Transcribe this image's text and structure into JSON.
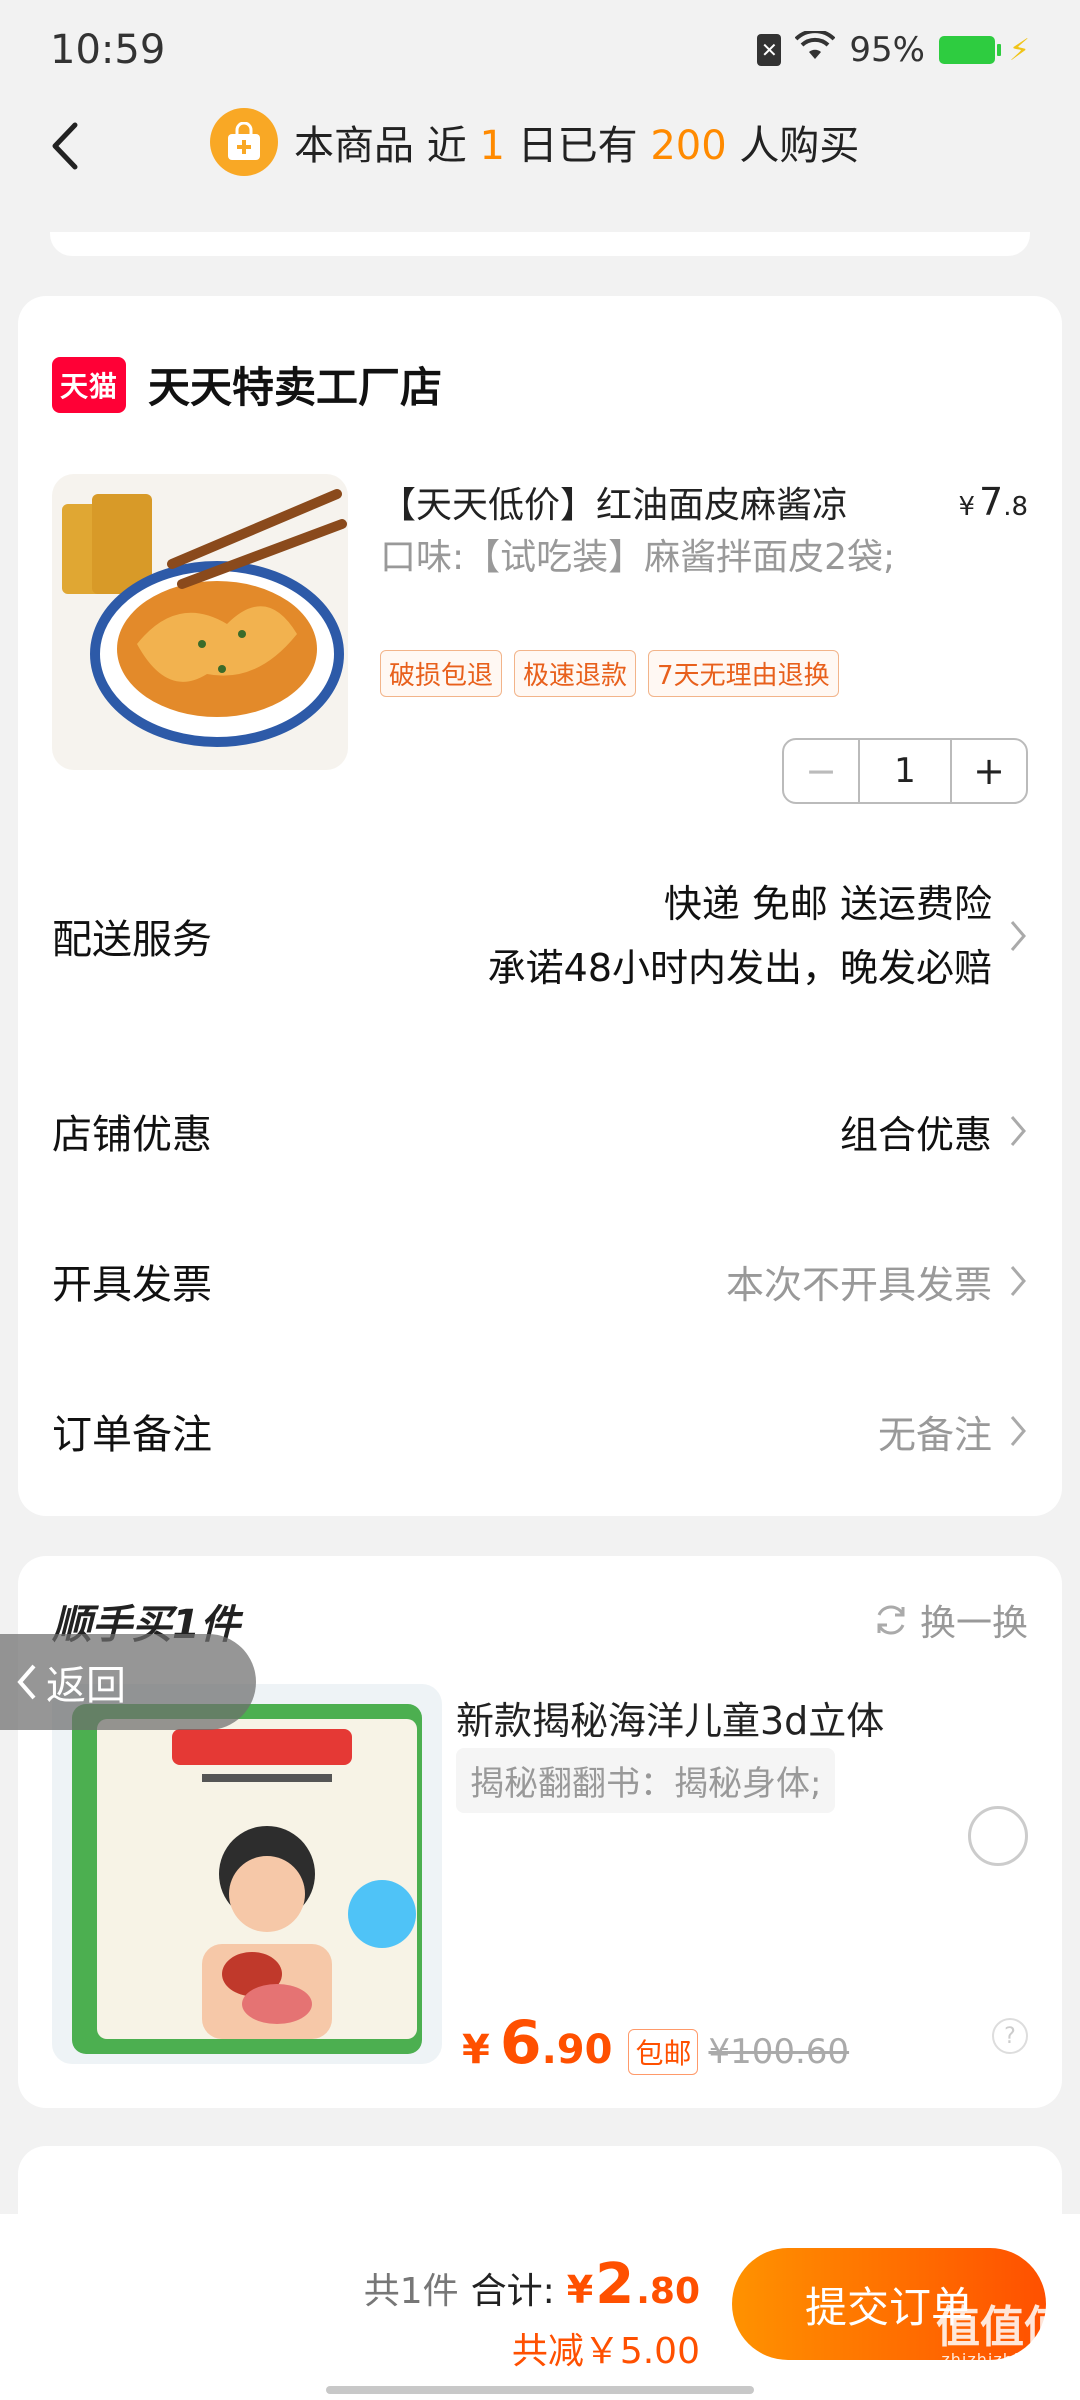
{
  "status": {
    "time": "10:59",
    "battery": "95%"
  },
  "header": {
    "text_pre": "本商品 近",
    "days": "1",
    "text_mid": "日已有",
    "count": "200",
    "text_post": "人购买"
  },
  "shop": {
    "logo_text": "天猫",
    "name": "天天特卖工厂店"
  },
  "product": {
    "title": "【天天低价】红油面皮麻酱凉",
    "price_symbol": "¥",
    "price_int": "7",
    "price_dec": ".8",
    "spec": "口味:【试吃装】麻酱拌面皮2袋;",
    "tags": [
      "破损包退",
      "极速退款",
      "7天无理由退换"
    ],
    "quantity": "1",
    "minus": "−",
    "plus": "+"
  },
  "rows": {
    "delivery_label": "配送服务",
    "delivery_line1": "快递 免邮 送运费险",
    "delivery_line2": "承诺48小时内发出，晚发必赔",
    "discount_label": "店铺优惠",
    "discount_value": "组合优惠",
    "invoice_label": "开具发票",
    "invoice_value": "本次不开具发票",
    "note_label": "订单备注",
    "note_value": "无备注"
  },
  "recommend": {
    "title": "顺手买1件",
    "refresh": "换一换",
    "name": "新款揭秘海洋儿童3d立体",
    "spec": "揭秘翻翻书：揭秘身体;",
    "price_symbol": "¥",
    "price_int": "6",
    "price_dec": ".90",
    "shipping_tag": "包邮",
    "orig_price": "¥100.60",
    "help": "?"
  },
  "float_back": "返回",
  "bottom": {
    "count": "共1件",
    "total_label": "合计:",
    "total_symbol": "¥",
    "total_int": "2",
    "total_dec": ".80",
    "saved": "共减￥5.00",
    "submit": "提交订单",
    "watermark": "值值值",
    "watermark_url": "zhizhizhi.com"
  },
  "colors": {
    "accent": "#ff5000",
    "highlight": "#ff8a00",
    "tmall": "#ff0036"
  }
}
